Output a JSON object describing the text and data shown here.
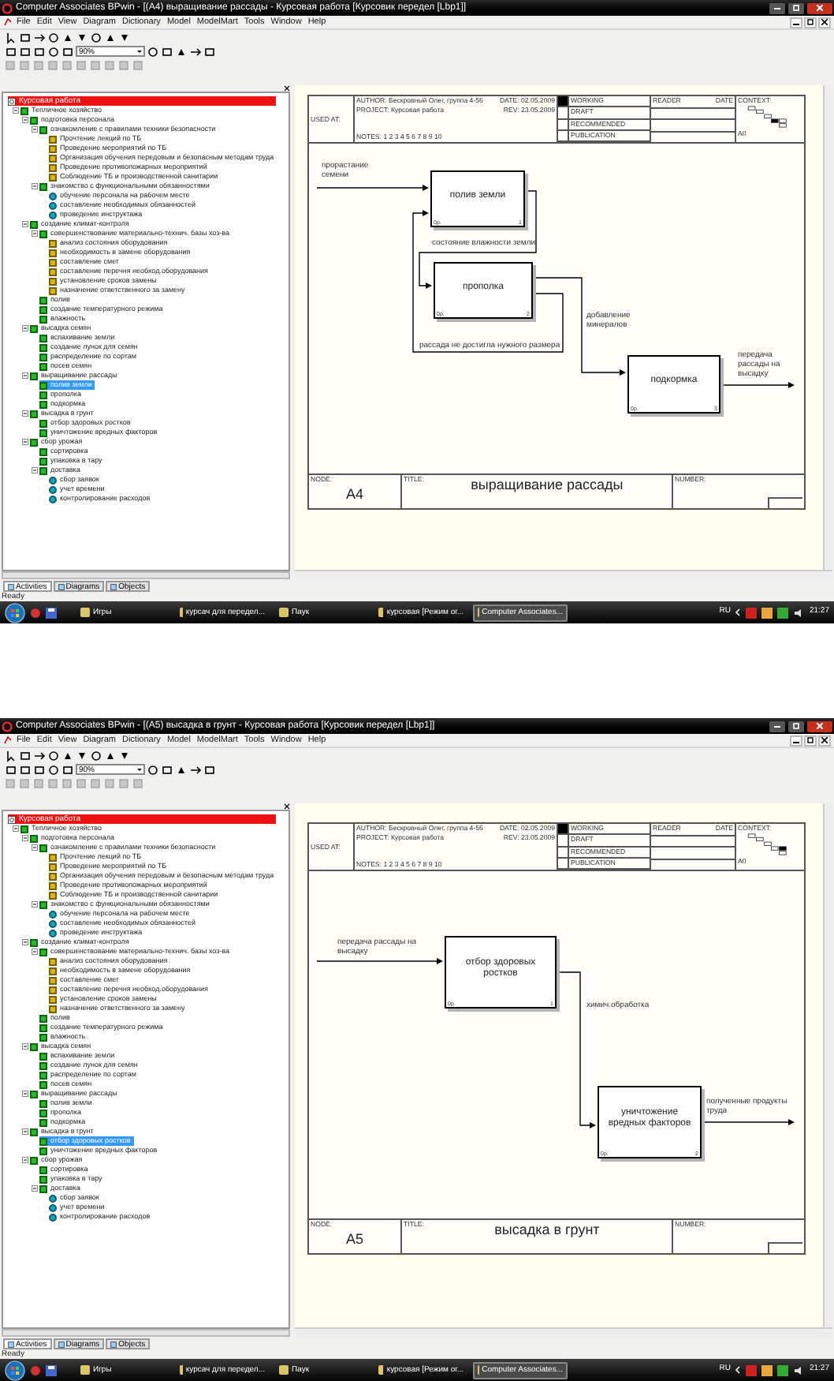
{
  "screens": [
    {
      "window": {
        "title": "Computer Associates BPwin - [(A4) выращивание рассады - Курсовая работа  [Курсовик передел [Lbp1]]"
      },
      "menu": [
        "File",
        "Edit",
        "View",
        "Diagram",
        "Dictionary",
        "Model",
        "ModelMart",
        "Tools",
        "Window",
        "Help"
      ],
      "toolbar": {
        "zoom": "90%"
      },
      "tree": {
        "root": {
          "label": "Курсовая работа"
        },
        "items": [
          {
            "label": "Тепличное хозяйство",
            "kind": "box",
            "selected": false,
            "expanded": true,
            "children": [
              {
                "label": "подготовка персонала",
                "kind": "box",
                "selected": false,
                "expanded": true,
                "children": [
                  {
                    "label": "ознакомление с правилами техники безопасности",
                    "kind": "box",
                    "selected": false,
                    "expanded": true,
                    "children": [
                      {
                        "label": "Прочтение лекций по ТБ",
                        "kind": "note",
                        "selected": false
                      },
                      {
                        "label": "Проведение мероприятий по ТБ",
                        "kind": "note",
                        "selected": false
                      },
                      {
                        "label": "Организация обучения передовым и безопасным методам труда",
                        "kind": "note",
                        "selected": false
                      },
                      {
                        "label": "Проведение противопожарных мероприятий",
                        "kind": "note",
                        "selected": false
                      },
                      {
                        "label": "Соблюдение ТБ и производственной санитарии",
                        "kind": "note",
                        "selected": false
                      }
                    ]
                  },
                  {
                    "label": "знакомство с функциональными обязанностями",
                    "kind": "box",
                    "selected": false,
                    "expanded": true,
                    "children": [
                      {
                        "label": "обучение персонала на рабочем месте",
                        "kind": "dot",
                        "selected": false
                      },
                      {
                        "label": "составление необходимых обязанностей",
                        "kind": "dot",
                        "selected": false
                      },
                      {
                        "label": "проведение инструктажа",
                        "kind": "dot",
                        "selected": false
                      }
                    ]
                  }
                ]
              },
              {
                "label": "создание климат-контроля",
                "kind": "box",
                "selected": false,
                "expanded": true,
                "children": [
                  {
                    "label": "совершенствование материально-технич. базы хоз-ва",
                    "kind": "box",
                    "selected": false,
                    "expanded": true,
                    "children": [
                      {
                        "label": "анализ состояния оборудования",
                        "kind": "note",
                        "selected": false
                      },
                      {
                        "label": "необходимость в замене оборудования",
                        "kind": "note",
                        "selected": false
                      },
                      {
                        "label": "составление смет",
                        "kind": "note",
                        "selected": false
                      },
                      {
                        "label": "составление перечня необход.оборудования",
                        "kind": "note",
                        "selected": false
                      },
                      {
                        "label": "установление сроков замены",
                        "kind": "note",
                        "selected": false
                      },
                      {
                        "label": "назначение ответственного за замену",
                        "kind": "note",
                        "selected": false
                      }
                    ]
                  },
                  {
                    "label": "полив",
                    "kind": "box",
                    "selected": false
                  },
                  {
                    "label": "создание  температурного режима",
                    "kind": "box",
                    "selected": false
                  },
                  {
                    "label": "влажность",
                    "kind": "box",
                    "selected": false
                  }
                ]
              },
              {
                "label": "высадка семян",
                "kind": "box",
                "selected": false,
                "expanded": true,
                "children": [
                  {
                    "label": "вспахивание земли",
                    "kind": "box",
                    "selected": false
                  },
                  {
                    "label": "создание лунок для семян",
                    "kind": "box",
                    "selected": false
                  },
                  {
                    "label": "распределение по сортам",
                    "kind": "box",
                    "selected": false
                  },
                  {
                    "label": "посев семян",
                    "kind": "box",
                    "selected": false
                  }
                ]
              },
              {
                "label": "выращивание рассады",
                "kind": "box",
                "selected": false,
                "expanded": true,
                "children": [
                  {
                    "label": "полив земли",
                    "kind": "box",
                    "selected": true
                  },
                  {
                    "label": "прополка",
                    "kind": "box",
                    "selected": false
                  },
                  {
                    "label": "подкормка",
                    "kind": "box",
                    "selected": false
                  }
                ]
              },
              {
                "label": "высадка в грунт",
                "kind": "box",
                "selected": false,
                "expanded": true,
                "children": [
                  {
                    "label": "отбор здоровых ростков",
                    "kind": "box",
                    "selected": false
                  },
                  {
                    "label": "уничтожение вредных факторов",
                    "kind": "box",
                    "selected": false
                  }
                ]
              },
              {
                "label": "сбор урожая",
                "kind": "box",
                "selected": false,
                "expanded": true,
                "children": [
                  {
                    "label": "сортировка",
                    "kind": "box",
                    "selected": false
                  },
                  {
                    "label": "упаковка в тару",
                    "kind": "box",
                    "selected": false
                  },
                  {
                    "label": "доставка",
                    "kind": "box",
                    "selected": false,
                    "expanded": true,
                    "children": [
                      {
                        "label": "сбор заявок",
                        "kind": "dot",
                        "selected": false
                      },
                      {
                        "label": "учет времени",
                        "kind": "dot",
                        "selected": false
                      },
                      {
                        "label": "контролирование расходов",
                        "kind": "dot",
                        "selected": false
                      }
                    ]
                  }
                ]
              }
            ]
          }
        ]
      },
      "tabs": [
        {
          "label": "Activities",
          "selected": true
        },
        {
          "label": "Diagrams",
          "selected": false
        },
        {
          "label": "Objects",
          "selected": false
        }
      ],
      "diagram": {
        "used_at": "USED AT:",
        "author": "AUTHOR:  Бескровный Олег, группа 4-56",
        "date": "DATE:  02.05.2009",
        "project": "PROJECT:  Курсовая работа",
        "rev": "REV:  23.05.2009",
        "notes": "NOTES:  1  2  3  4  5  6  7  8  9  10",
        "statuses": [
          {
            "label": "WORKING",
            "selected": true
          },
          {
            "label": "DRAFT",
            "selected": false
          },
          {
            "label": "RECOMMENDED",
            "selected": false
          },
          {
            "label": "PUBLICATION",
            "selected": false
          }
        ],
        "reader": "READER",
        "reader_date": "DATE",
        "context": "CONTEXT:",
        "context_node": "A0",
        "context_boxes": [
          {
            "selected": false
          },
          {
            "selected": false
          },
          {
            "selected": false
          },
          {
            "selected": true
          },
          {
            "selected": false
          },
          {
            "selected": false
          }
        ],
        "boxes": [
          {
            "label": "полив земли",
            "cost": "0р.",
            "number": "1"
          },
          {
            "label": "прополка",
            "cost": "0р.",
            "number": "2"
          },
          {
            "label": "подкормка",
            "cost": "0р.",
            "number": "3"
          }
        ],
        "arrows": [
          {
            "label": "прорастание семени"
          },
          {
            "label": "состояние влажности земли"
          },
          {
            "label": "рассада не достигла нужного размера"
          },
          {
            "label": "добавление минералов"
          },
          {
            "label": "передача рассады на высадку"
          }
        ],
        "node_label": "NODE:",
        "node": "A4",
        "title_label": "TITLE:",
        "title": "выращивание рассады",
        "number_label": "NUMBER:"
      },
      "status_bar": "Ready",
      "taskbar": {
        "tasks": [
          {
            "label": "Игры",
            "selected": false
          },
          {
            "label": "курсач для передел...",
            "selected": false
          },
          {
            "label": "Паук",
            "selected": false
          },
          {
            "label": "курсовая [Режим ог...",
            "selected": false
          },
          {
            "label": "Computer Associates...",
            "selected": true
          }
        ],
        "language": "RU",
        "clock": "21:27"
      }
    },
    {
      "window": {
        "title": "Computer Associates BPwin - [(A5) высадка в грунт - Курсовая работа  [Курсовик передел [Lbp1]]"
      },
      "menu": [
        "File",
        "Edit",
        "View",
        "Diagram",
        "Dictionary",
        "Model",
        "ModelMart",
        "Tools",
        "Window",
        "Help"
      ],
      "toolbar": {
        "zoom": "90%"
      },
      "tree": {
        "root": {
          "label": "Курсовая работа"
        },
        "items": [
          {
            "label": "Тепличное хозяйство",
            "kind": "box",
            "selected": false,
            "expanded": true,
            "children": [
              {
                "label": "подготовка персонала",
                "kind": "box",
                "selected": false,
                "expanded": true,
                "children": [
                  {
                    "label": "ознакомление с правилами техники безопасности",
                    "kind": "box",
                    "selected": false,
                    "expanded": true,
                    "children": [
                      {
                        "label": "Прочтение лекций по ТБ",
                        "kind": "note",
                        "selected": false
                      },
                      {
                        "label": "Проведение мероприятий по ТБ",
                        "kind": "note",
                        "selected": false
                      },
                      {
                        "label": "Организация обучения передовым и безопасным методам труда",
                        "kind": "note",
                        "selected": false
                      },
                      {
                        "label": "Проведение противопожарных мероприятий",
                        "kind": "note",
                        "selected": false
                      },
                      {
                        "label": "Соблюдение ТБ и производственной санитарии",
                        "kind": "note",
                        "selected": false
                      }
                    ]
                  },
                  {
                    "label": "знакомство с функциональными обязанностями",
                    "kind": "box",
                    "selected": false,
                    "expanded": true,
                    "children": [
                      {
                        "label": "обучение персонала на рабочем месте",
                        "kind": "dot",
                        "selected": false
                      },
                      {
                        "label": "составление необходимых обязанностей",
                        "kind": "dot",
                        "selected": false
                      },
                      {
                        "label": "проведение инструктажа",
                        "kind": "dot",
                        "selected": false
                      }
                    ]
                  }
                ]
              },
              {
                "label": "создание климат-контроля",
                "kind": "box",
                "selected": false,
                "expanded": true,
                "children": [
                  {
                    "label": "совершенствование материально-технич. базы хоз-ва",
                    "kind": "box",
                    "selected": false,
                    "expanded": true,
                    "children": [
                      {
                        "label": "анализ состояния оборудования",
                        "kind": "note",
                        "selected": false
                      },
                      {
                        "label": "необходимость в замене оборудования",
                        "kind": "note",
                        "selected": false
                      },
                      {
                        "label": "составление смет",
                        "kind": "note",
                        "selected": false
                      },
                      {
                        "label": "составление перечня необход.оборудования",
                        "kind": "note",
                        "selected": false
                      },
                      {
                        "label": "установление сроков замены",
                        "kind": "note",
                        "selected": false
                      },
                      {
                        "label": "назначение ответственного за замену",
                        "kind": "note",
                        "selected": false
                      }
                    ]
                  },
                  {
                    "label": "полив",
                    "kind": "box",
                    "selected": false
                  },
                  {
                    "label": "создание  температурного режима",
                    "kind": "box",
                    "selected": false
                  },
                  {
                    "label": "влажность",
                    "kind": "box",
                    "selected": false
                  }
                ]
              },
              {
                "label": "высадка семян",
                "kind": "box",
                "selected": false,
                "expanded": true,
                "children": [
                  {
                    "label": "вспахивание земли",
                    "kind": "box",
                    "selected": false
                  },
                  {
                    "label": "создание лунок для семян",
                    "kind": "box",
                    "selected": false
                  },
                  {
                    "label": "распределение по сортам",
                    "kind": "box",
                    "selected": false
                  },
                  {
                    "label": "посев семян",
                    "kind": "box",
                    "selected": false
                  }
                ]
              },
              {
                "label": "выращивание рассады",
                "kind": "box",
                "selected": false,
                "expanded": true,
                "children": [
                  {
                    "label": "полив земли",
                    "kind": "box",
                    "selected": false
                  },
                  {
                    "label": "прополка",
                    "kind": "box",
                    "selected": false
                  },
                  {
                    "label": "подкормка",
                    "kind": "box",
                    "selected": false
                  }
                ]
              },
              {
                "label": "высадка в грунт",
                "kind": "box",
                "selected": false,
                "expanded": true,
                "children": [
                  {
                    "label": "отбор здоровых ростков",
                    "kind": "box",
                    "selected": true
                  },
                  {
                    "label": "уничтожение вредных факторов",
                    "kind": "box",
                    "selected": false
                  }
                ]
              },
              {
                "label": "сбор урожая",
                "kind": "box",
                "selected": false,
                "expanded": true,
                "children": [
                  {
                    "label": "сортировка",
                    "kind": "box",
                    "selected": false
                  },
                  {
                    "label": "упаковка в тару",
                    "kind": "box",
                    "selected": false
                  },
                  {
                    "label": "доставка",
                    "kind": "box",
                    "selected": false,
                    "expanded": true,
                    "children": [
                      {
                        "label": "сбор заявок",
                        "kind": "dot",
                        "selected": false
                      },
                      {
                        "label": "учет времени",
                        "kind": "dot",
                        "selected": false
                      },
                      {
                        "label": "контролирование расходов",
                        "kind": "dot",
                        "selected": false
                      }
                    ]
                  }
                ]
              }
            ]
          }
        ]
      },
      "tabs": [
        {
          "label": "Activities",
          "selected": true
        },
        {
          "label": "Diagrams",
          "selected": false
        },
        {
          "label": "Objects",
          "selected": false
        }
      ],
      "diagram": {
        "used_at": "USED AT:",
        "author": "AUTHOR:  Бескровный Олег, группа 4-56",
        "date": "DATE:  02.05.2009",
        "project": "PROJECT:  Курсовая работа",
        "rev": "REV:  23.05.2009",
        "notes": "NOTES:  1  2  3  4  5  6  7  8  9  10",
        "statuses": [
          {
            "label": "WORKING",
            "selected": true
          },
          {
            "label": "DRAFT",
            "selected": false
          },
          {
            "label": "RECOMMENDED",
            "selected": false
          },
          {
            "label": "PUBLICATION",
            "selected": false
          }
        ],
        "reader": "READER",
        "reader_date": "DATE",
        "context": "CONTEXT:",
        "context_node": "A0",
        "context_boxes": [
          {
            "selected": false
          },
          {
            "selected": false
          },
          {
            "selected": false
          },
          {
            "selected": false
          },
          {
            "selected": true
          },
          {
            "selected": false
          }
        ],
        "boxes": [
          {
            "label": "отбор здоровых ростков",
            "cost": "0р.",
            "number": "1"
          },
          {
            "label": "уничтожение вредных факторов",
            "cost": "0р.",
            "number": "2"
          }
        ],
        "arrows": [
          {
            "label": "передача рассады на высадку"
          },
          {
            "label": "химич.обработка"
          },
          {
            "label": "полученные продукты труда"
          }
        ],
        "node_label": "NODE:",
        "node": "A5",
        "title_label": "TITLE:",
        "title": "высадка в грунт",
        "number_label": "NUMBER:"
      },
      "status_bar": "Ready",
      "taskbar": {
        "tasks": [
          {
            "label": "Игры",
            "selected": false
          },
          {
            "label": "курсач для передел...",
            "selected": false
          },
          {
            "label": "Паук",
            "selected": false
          },
          {
            "label": "курсовая [Режим ог...",
            "selected": false
          },
          {
            "label": "Computer Associates...",
            "selected": true
          }
        ],
        "language": "RU",
        "clock": "21:27"
      }
    }
  ]
}
